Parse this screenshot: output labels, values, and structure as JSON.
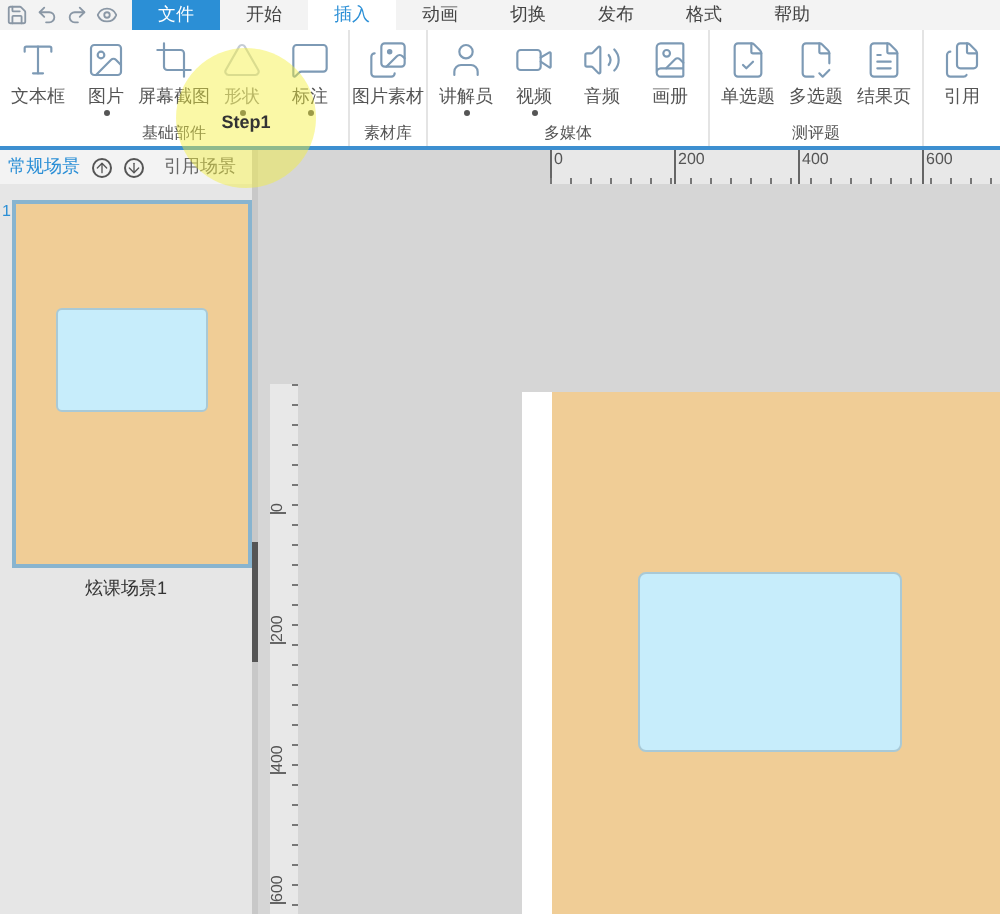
{
  "tabs": [
    {
      "label": "文件",
      "kind": "file",
      "selected": false
    },
    {
      "label": "开始",
      "kind": "tab",
      "selected": false
    },
    {
      "label": "插入",
      "kind": "tab",
      "selected": true
    },
    {
      "label": "动画",
      "kind": "tab",
      "selected": false
    },
    {
      "label": "切换",
      "kind": "tab",
      "selected": false
    },
    {
      "label": "发布",
      "kind": "tab",
      "selected": false
    },
    {
      "label": "格式",
      "kind": "tab",
      "selected": false
    },
    {
      "label": "帮助",
      "kind": "tab",
      "selected": false
    }
  ],
  "ribbon_groups": [
    {
      "label": "基础部件",
      "items": [
        {
          "label": "文本框",
          "has_menu": false,
          "disabled": false
        },
        {
          "label": "图片",
          "has_menu": true,
          "disabled": false
        },
        {
          "label": "屏幕截图",
          "has_menu": false,
          "disabled": false
        },
        {
          "label": "形状",
          "has_menu": true,
          "disabled": true
        },
        {
          "label": "标注",
          "has_menu": true,
          "disabled": false
        }
      ]
    },
    {
      "label": "素材库",
      "items": [
        {
          "label": "图片素材",
          "has_menu": false,
          "disabled": false
        }
      ]
    },
    {
      "label": "多媒体",
      "items": [
        {
          "label": "讲解员",
          "has_menu": true,
          "disabled": false
        },
        {
          "label": "视频",
          "has_menu": true,
          "disabled": false
        },
        {
          "label": "音频",
          "has_menu": false,
          "disabled": false
        },
        {
          "label": "画册",
          "has_menu": false,
          "disabled": false
        }
      ]
    },
    {
      "label": "测评题",
      "items": [
        {
          "label": "单选题",
          "has_menu": false,
          "disabled": false
        },
        {
          "label": "多选题",
          "has_menu": false,
          "disabled": false
        },
        {
          "label": "结果页",
          "has_menu": false,
          "disabled": false
        }
      ]
    },
    {
      "items": [
        {
          "label": "引用",
          "has_menu": false,
          "disabled": false
        }
      ]
    }
  ],
  "highlight": {
    "label": "Step1"
  },
  "panel_tabs": [
    {
      "label": "常规场景",
      "selected": true
    },
    {
      "label": "引用场景",
      "selected": false
    }
  ],
  "scenes": [
    {
      "number": "1",
      "name": "炫课场景1",
      "selected": true
    }
  ],
  "ruler_h": [
    "0",
    "200",
    "400",
    "600"
  ],
  "ruler_v": [
    "0",
    "200",
    "400",
    "600"
  ]
}
